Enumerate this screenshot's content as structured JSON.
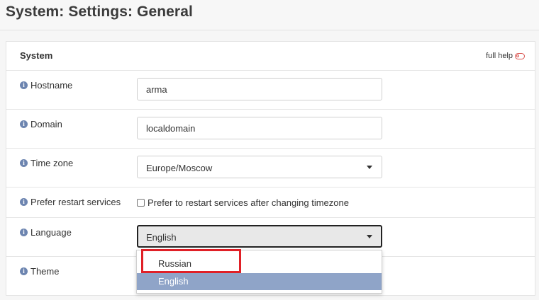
{
  "page": {
    "title": "System: Settings: General"
  },
  "panel": {
    "section_title": "System",
    "full_help_label": "full help"
  },
  "fields": {
    "hostname": {
      "label": "Hostname",
      "value": "arma"
    },
    "domain": {
      "label": "Domain",
      "value": "localdomain"
    },
    "timezone": {
      "label": "Time zone",
      "value": "Europe/Moscow"
    },
    "prefer_restart": {
      "label": "Prefer restart services",
      "checkbox_label": "Prefer to restart services after changing timezone",
      "checked": false
    },
    "language": {
      "label": "Language",
      "value": "English",
      "options": [
        "Russian",
        "English"
      ],
      "selected_option": "English"
    },
    "theme": {
      "label": "Theme"
    }
  },
  "colors": {
    "selected_option_bg": "#8fa4c8",
    "highlight_border": "#e02027",
    "info_icon": "#6d85b0"
  }
}
